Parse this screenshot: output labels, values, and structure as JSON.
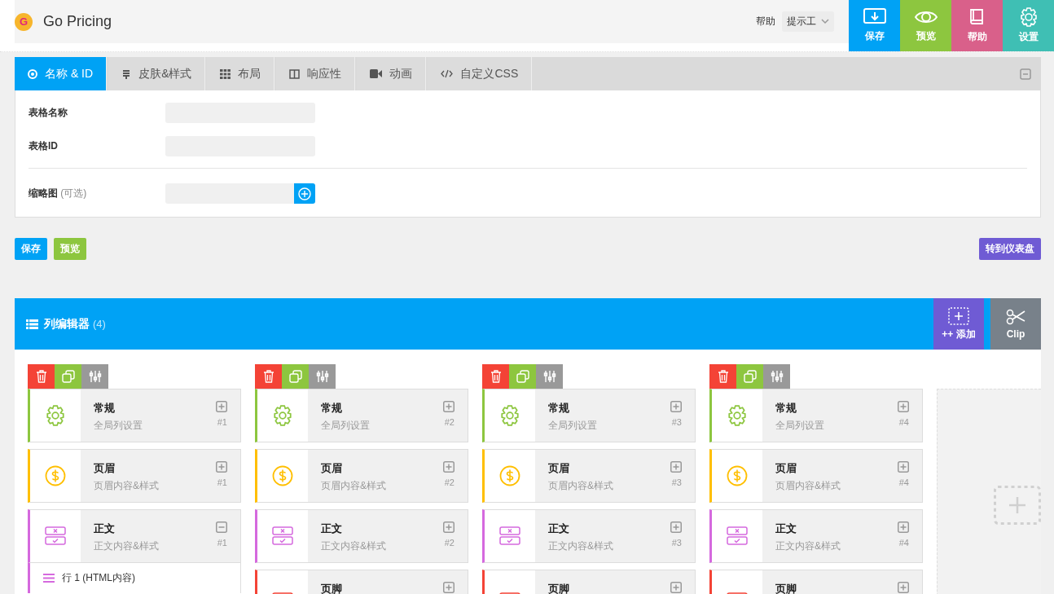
{
  "header": {
    "logo_letter": "G",
    "title": "Go Pricing",
    "help_label": "帮助",
    "tooltip_select": "提示工",
    "actions": [
      {
        "kind": "save",
        "label": "保存"
      },
      {
        "kind": "preview",
        "label": "预览"
      },
      {
        "kind": "help",
        "label": "帮助"
      },
      {
        "kind": "settings",
        "label": "设置"
      }
    ]
  },
  "tabs": [
    {
      "kind": "target",
      "label": "名称 & ID",
      "selected": true
    },
    {
      "kind": "skin",
      "label": "皮肤&样式",
      "selected": false
    },
    {
      "kind": "grid",
      "label": "布局",
      "selected": false
    },
    {
      "kind": "columns",
      "label": "响应性",
      "selected": false
    },
    {
      "kind": "video",
      "label": "动画",
      "selected": false
    },
    {
      "kind": "code",
      "label": "自定义CSS",
      "selected": false
    }
  ],
  "form": {
    "fields": [
      {
        "label": "表格名称",
        "kind": "text"
      },
      {
        "label": "表格ID",
        "kind": "text"
      },
      {
        "label": "缩略图",
        "hint": "(可选)",
        "kind": "image"
      }
    ]
  },
  "buttons": [
    {
      "kind": "save",
      "label": "保存"
    },
    {
      "kind": "preview",
      "label": "预览"
    },
    {
      "kind": "dashboard",
      "label": "转到仪表盘"
    }
  ],
  "column_editor": {
    "title": "列编辑器",
    "count": "(4)",
    "actions": [
      {
        "kind": "add",
        "label": "++ 添加"
      },
      {
        "kind": "clip",
        "label": "Clip"
      }
    ],
    "columns": [
      {
        "sections": [
          {
            "kind": "general",
            "title": "常规",
            "subtitle": "全局列设置",
            "number": "#1",
            "expanded": false
          },
          {
            "kind": "header",
            "title": "页眉",
            "subtitle": "页眉内容&样式",
            "number": "#1",
            "expanded": false
          },
          {
            "kind": "body",
            "title": "正文",
            "subtitle": "正文内容&样式",
            "number": "#1",
            "expanded": true,
            "rows": [
              "行 1 (HTML内容)"
            ]
          }
        ]
      },
      {
        "sections": [
          {
            "kind": "general",
            "title": "常规",
            "subtitle": "全局列设置",
            "number": "#2",
            "expanded": false
          },
          {
            "kind": "header",
            "title": "页眉",
            "subtitle": "页眉内容&样式",
            "number": "#2",
            "expanded": false
          },
          {
            "kind": "body",
            "title": "正文",
            "subtitle": "正文内容&样式",
            "number": "#2",
            "expanded": false
          },
          {
            "kind": "footer",
            "title": "页脚",
            "expanded": false
          }
        ]
      },
      {
        "sections": [
          {
            "kind": "general",
            "title": "常规",
            "subtitle": "全局列设置",
            "number": "#3",
            "expanded": false
          },
          {
            "kind": "header",
            "title": "页眉",
            "subtitle": "页眉内容&样式",
            "number": "#3",
            "expanded": false
          },
          {
            "kind": "body",
            "title": "正文",
            "subtitle": "正文内容&样式",
            "number": "#3",
            "expanded": false
          },
          {
            "kind": "footer",
            "title": "页脚",
            "expanded": false
          }
        ]
      },
      {
        "sections": [
          {
            "kind": "general",
            "title": "常规",
            "subtitle": "全局列设置",
            "number": "#4",
            "expanded": false
          },
          {
            "kind": "header",
            "title": "页眉",
            "subtitle": "页眉内容&样式",
            "number": "#4",
            "expanded": false
          },
          {
            "kind": "body",
            "title": "正文",
            "subtitle": "正文内容&样式",
            "number": "#4",
            "expanded": false
          },
          {
            "kind": "footer",
            "title": "页脚",
            "expanded": false
          }
        ]
      }
    ]
  }
}
